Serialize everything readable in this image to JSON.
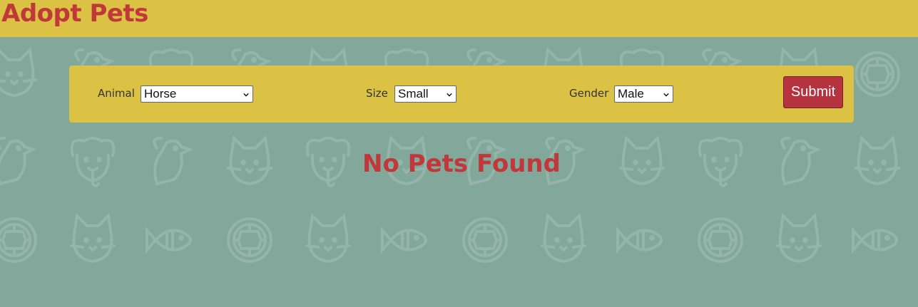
{
  "header": {
    "title": "Adopt Pets"
  },
  "filters": {
    "animal": {
      "label": "Animal",
      "selected": "Horse"
    },
    "size": {
      "label": "Size",
      "selected": "Small"
    },
    "gender": {
      "label": "Gender",
      "selected": "Male"
    },
    "submit_label": "Submit"
  },
  "results": {
    "empty_message": "No Pets Found"
  },
  "colors": {
    "background": "#82a79b",
    "panel": "#dbc144",
    "accent_red": "#c0383a",
    "button": "#b5333e"
  },
  "background_icons": [
    "dog-icon",
    "bird-icon",
    "cat-icon",
    "fish-icon",
    "turtle-icon"
  ]
}
